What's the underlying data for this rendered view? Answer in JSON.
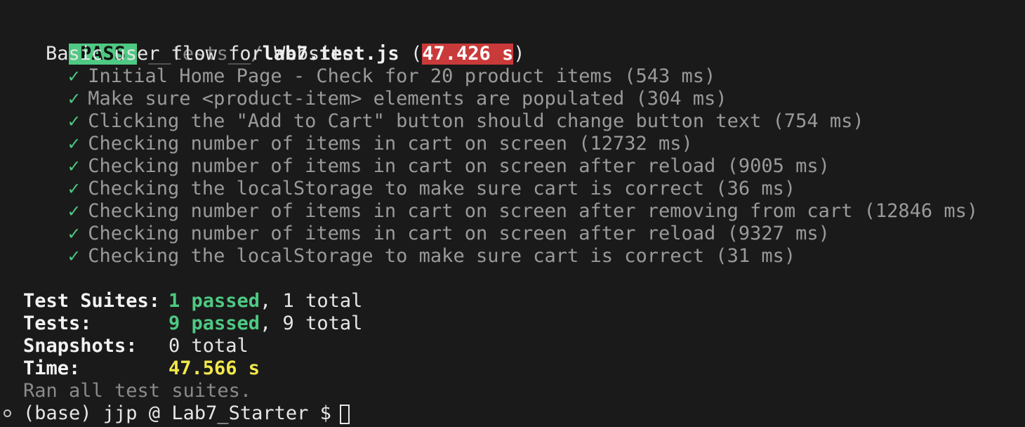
{
  "header": {
    "status": "PASS",
    "path_dir": "__tests__/",
    "path_file": "lab7.test.js",
    "open_paren": "(",
    "duration": "47.426 s",
    "close_paren": ")"
  },
  "suite_name": "Basic user flow for Website",
  "check_glyph": "✓",
  "tests": [
    "Initial Home Page - Check for 20 product items (543 ms)",
    "Make sure <product-item> elements are populated (304 ms)",
    "Clicking the \"Add to Cart\" button should change button text (754 ms)",
    "Checking number of items in cart on screen (12732 ms)",
    "Checking number of items in cart on screen after reload (9005 ms)",
    "Checking the localStorage to make sure cart is correct (36 ms)",
    "Checking number of items in cart on screen after removing from cart (12846 ms)",
    "Checking number of items in cart on screen after reload (9327 ms)",
    "Checking the localStorage to make sure cart is correct (31 ms)"
  ],
  "summary": {
    "suites_label": "Test Suites:",
    "suites_passed": "1 passed",
    "suites_total": ", 1 total",
    "tests_label": "Tests:",
    "tests_passed": "9 passed",
    "tests_total": ", 9 total",
    "snapshots_label": "Snapshots:",
    "snapshots_value": "0 total",
    "time_label": "Time:",
    "time_value": "47.566 s",
    "ran_all": "Ran all test suites."
  },
  "prompt": {
    "text": "(base) jjp @ Lab7_Starter $"
  },
  "colors": {
    "background": "#1a1a1a",
    "pass": "#4ec982",
    "slow_time": "#c93a3a",
    "time_total": "#f2e84b"
  }
}
